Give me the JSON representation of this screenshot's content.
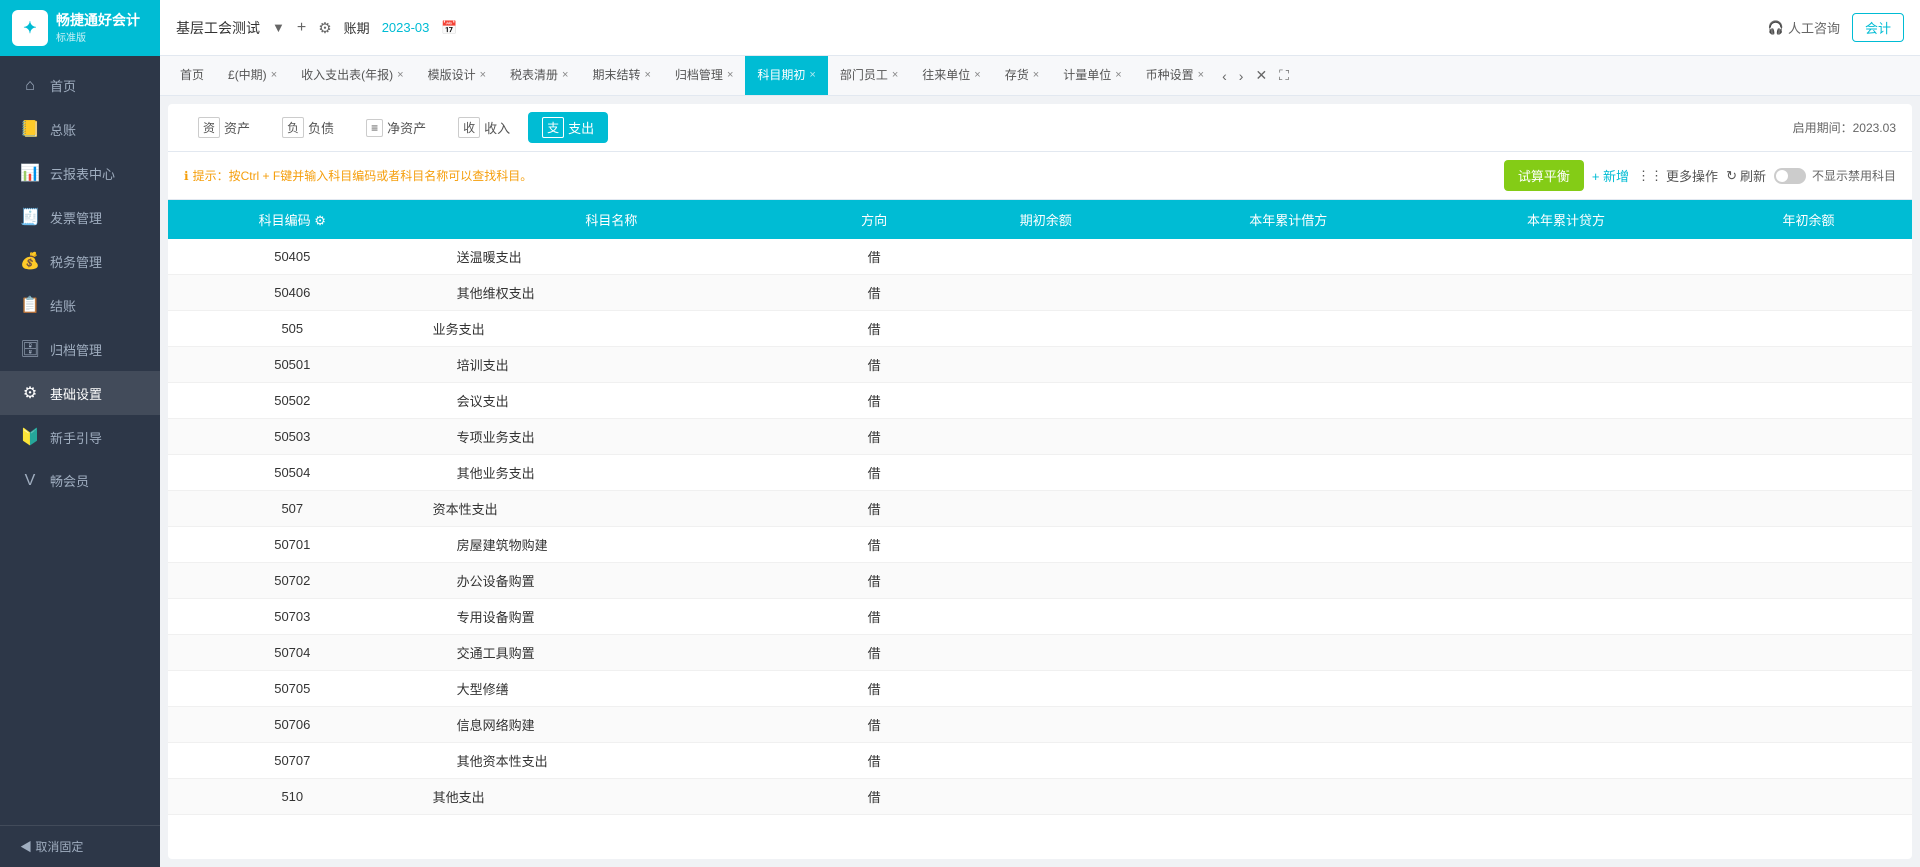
{
  "app": {
    "logo_text": "畅捷通好会计",
    "logo_sub": "标准版",
    "logo_icon": "✦"
  },
  "sidebar": {
    "items": [
      {
        "id": "home",
        "label": "首页",
        "icon": "⌂"
      },
      {
        "id": "ledger",
        "label": "总账",
        "icon": "📒"
      },
      {
        "id": "reports",
        "label": "云报表中心",
        "icon": "📊"
      },
      {
        "id": "invoice",
        "label": "发票管理",
        "icon": "🧾"
      },
      {
        "id": "tax",
        "label": "税务管理",
        "icon": "💰"
      },
      {
        "id": "checkout",
        "label": "结账",
        "icon": "📋"
      },
      {
        "id": "archive",
        "label": "归档管理",
        "icon": "🗄"
      },
      {
        "id": "settings",
        "label": "基础设置",
        "icon": "⚙"
      },
      {
        "id": "guide",
        "label": "新手引导",
        "icon": "🔰"
      },
      {
        "id": "member",
        "label": "畅会员",
        "icon": "V"
      }
    ],
    "footer": "◀ 取消固定"
  },
  "topbar": {
    "company": "基层工会测试",
    "period_label": "账期",
    "period_value": "2023-03",
    "customer_service": "人工咨询",
    "account_btn": "会计"
  },
  "tabs": [
    {
      "id": "home",
      "label": "首页",
      "closable": false
    },
    {
      "id": "period",
      "label": "£(中期)",
      "closable": true
    },
    {
      "id": "income_report",
      "label": "收入支出表(年报)",
      "closable": true
    },
    {
      "id": "template",
      "label": "模版设计",
      "closable": true
    },
    {
      "id": "tax_clear",
      "label": "税表清册",
      "closable": true
    },
    {
      "id": "period_end",
      "label": "期末结转",
      "closable": true
    },
    {
      "id": "archive",
      "label": "归档管理",
      "closable": true
    },
    {
      "id": "subject_period",
      "label": "科目期初",
      "closable": true,
      "active": true
    },
    {
      "id": "dept_staff",
      "label": "部门员工",
      "closable": true
    },
    {
      "id": "units",
      "label": "往来单位",
      "closable": true
    },
    {
      "id": "inventory",
      "label": "存货",
      "closable": true
    },
    {
      "id": "measure",
      "label": "计量单位",
      "closable": true
    },
    {
      "id": "currency",
      "label": "币种设置",
      "closable": true
    }
  ],
  "subtabs": [
    {
      "id": "assets",
      "label": "资产",
      "icon": "资"
    },
    {
      "id": "liability",
      "label": "负债",
      "icon": "负"
    },
    {
      "id": "net_assets",
      "label": "净资产",
      "icon": "≡"
    },
    {
      "id": "income",
      "label": "收入",
      "icon": "收"
    },
    {
      "id": "expense",
      "label": "支出",
      "icon": "支",
      "active": true
    }
  ],
  "period_display": "启用期间：2023.03",
  "hint": "提示：按Ctrl + F键并输入科目编码或者科目名称可以查找科目。",
  "toolbar": {
    "balance_btn": "试算平衡",
    "add_btn": "+ 新增",
    "more_btn": "更多操作",
    "refresh_btn": "刷新",
    "toggle_label": "不显示禁用科目"
  },
  "table": {
    "columns": [
      "科目编码",
      "科目名称",
      "方向",
      "期初余额",
      "本年累计借方",
      "本年累计贷方",
      "年初余额"
    ],
    "rows": [
      {
        "code": "50405",
        "name": "送温暖支出",
        "dir": "借",
        "parent": false
      },
      {
        "code": "50406",
        "name": "其他维权支出",
        "dir": "借",
        "parent": false
      },
      {
        "code": "505",
        "name": "业务支出",
        "dir": "借",
        "parent": true
      },
      {
        "code": "50501",
        "name": "培训支出",
        "dir": "借",
        "parent": false
      },
      {
        "code": "50502",
        "name": "会议支出",
        "dir": "借",
        "parent": false
      },
      {
        "code": "50503",
        "name": "专项业务支出",
        "dir": "借",
        "parent": false
      },
      {
        "code": "50504",
        "name": "其他业务支出",
        "dir": "借",
        "parent": false
      },
      {
        "code": "507",
        "name": "资本性支出",
        "dir": "借",
        "parent": true
      },
      {
        "code": "50701",
        "name": "房屋建筑物购建",
        "dir": "借",
        "parent": false
      },
      {
        "code": "50702",
        "name": "办公设备购置",
        "dir": "借",
        "parent": false
      },
      {
        "code": "50703",
        "name": "专用设备购置",
        "dir": "借",
        "parent": false
      },
      {
        "code": "50704",
        "name": "交通工具购置",
        "dir": "借",
        "parent": false
      },
      {
        "code": "50705",
        "name": "大型修缮",
        "dir": "借",
        "parent": false
      },
      {
        "code": "50706",
        "name": "信息网络购建",
        "dir": "借",
        "parent": false
      },
      {
        "code": "50707",
        "name": "其他资本性支出",
        "dir": "借",
        "parent": false
      },
      {
        "code": "510",
        "name": "其他支出",
        "dir": "借",
        "parent": true
      }
    ]
  }
}
